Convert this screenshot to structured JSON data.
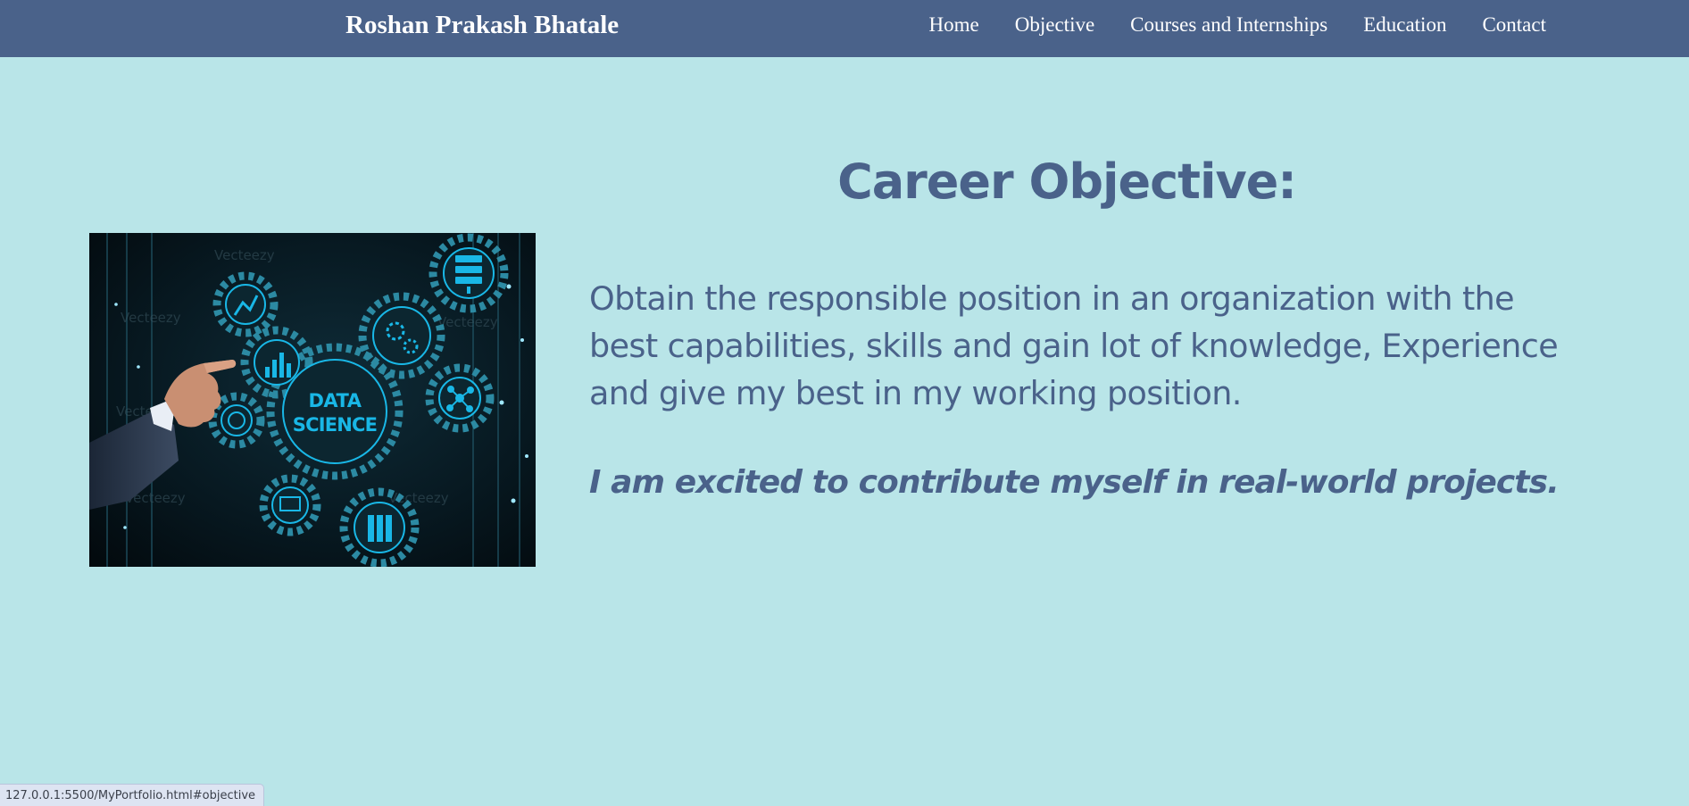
{
  "brand": "Roshan Prakash Bhatale",
  "nav": {
    "items": [
      "Home",
      "Objective",
      "Courses and Internships",
      "Education",
      "Contact"
    ]
  },
  "image": {
    "text_line1": "DATA",
    "text_line2": "SCIENCE",
    "watermark": "Vecteezy"
  },
  "main": {
    "heading": "Career Objective:",
    "objective_lines": [
      "Obtain the responsible position in an organization with the",
      "best capabilities, skills and gain lot of knowledge, Experience",
      "and give my best in my working position."
    ],
    "tagline": "I am excited to contribute myself in real-world projects."
  },
  "status_bar": {
    "url": "127.0.0.1:5500/MyPortfolio.html#objective"
  },
  "colors": {
    "background": "#b9e5e8",
    "navbar": "#4a628a",
    "text": "#4a628a",
    "nav_text": "#ffffff",
    "image_accent": "#19b7e6"
  }
}
